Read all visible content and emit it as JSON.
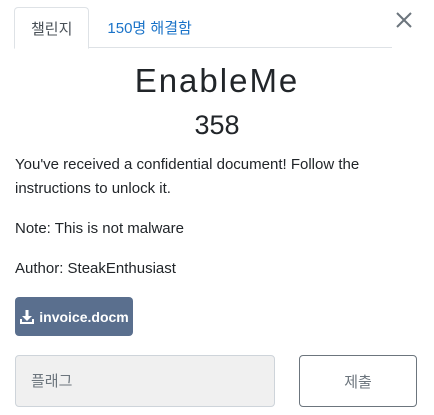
{
  "tabs": [
    {
      "label": "챌린지"
    },
    {
      "label": "150명 해결함"
    }
  ],
  "challenge": {
    "name": "EnableMe",
    "value": "358",
    "description": "You've received a confidential document! Follow the instructions to unlock it.",
    "note": "Note: This is not malware",
    "author": "Author: SteakEnthusiast"
  },
  "file": {
    "name": "invoice.docm",
    "icon": "download-icon"
  },
  "form": {
    "flag_placeholder": "플래그",
    "submit_label": "제출"
  },
  "icons": {
    "close": "close-icon"
  },
  "colors": {
    "link": "#1a73c8",
    "file_button": "#5a6f8e",
    "input_bg": "#f0f0f0"
  }
}
